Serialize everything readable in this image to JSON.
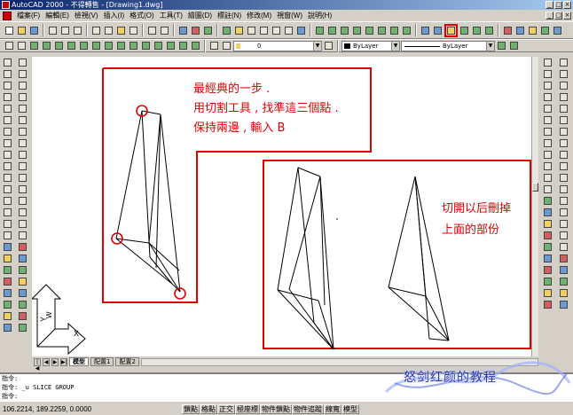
{
  "window": {
    "title": "AutoCAD 2000 - 不得轉售 - [Drawing1.dwg]",
    "controls": [
      "_",
      "□",
      "×"
    ]
  },
  "menu": {
    "items": [
      "檔案(F)",
      "編輯(E)",
      "檢視(V)",
      "插入(I)",
      "格式(O)",
      "工具(T)",
      "繪圖(D)",
      "標註(N)",
      "修改(M)",
      "視窗(W)",
      "說明(H)"
    ],
    "doc_controls": [
      "_",
      "□",
      "×"
    ]
  },
  "properties_bar": {
    "layer_value": "0",
    "color_value": "ByLayer",
    "linetype_value": "ByLayer",
    "arrow": "▼"
  },
  "annotations": {
    "instructions": [
      "最經典的一步 .",
      "用切割工具 , 找準這三個點 .",
      "保持兩邊 , 輸入 B"
    ],
    "result": [
      "切開以后刪掉",
      "上面的部份"
    ]
  },
  "ucs": {
    "x_label": "X",
    "y_label": "Y",
    "w_label": "W"
  },
  "layout_tabs": {
    "nav": [
      "|◀",
      "◀",
      "▶",
      "▶|"
    ],
    "tabs": [
      "模型",
      "配置1",
      "配置2"
    ],
    "active": "模型"
  },
  "command": {
    "lines": [
      "指令:",
      "指令: _u SLICE GROUP",
      "指令:"
    ]
  },
  "status": {
    "coordinates": "106.2214, 189.2259, 0.0000",
    "buttons": [
      "鎖點",
      "格點",
      "正交",
      "極座標",
      "物件鎖點",
      "物件追蹤",
      "線寬",
      "模型"
    ]
  },
  "watermark": "怒剑红颜的教程",
  "colors": {
    "annotation_red": "#e00000",
    "title_blue": "#0a246a",
    "watermark_blue": "#2a3aa8"
  }
}
